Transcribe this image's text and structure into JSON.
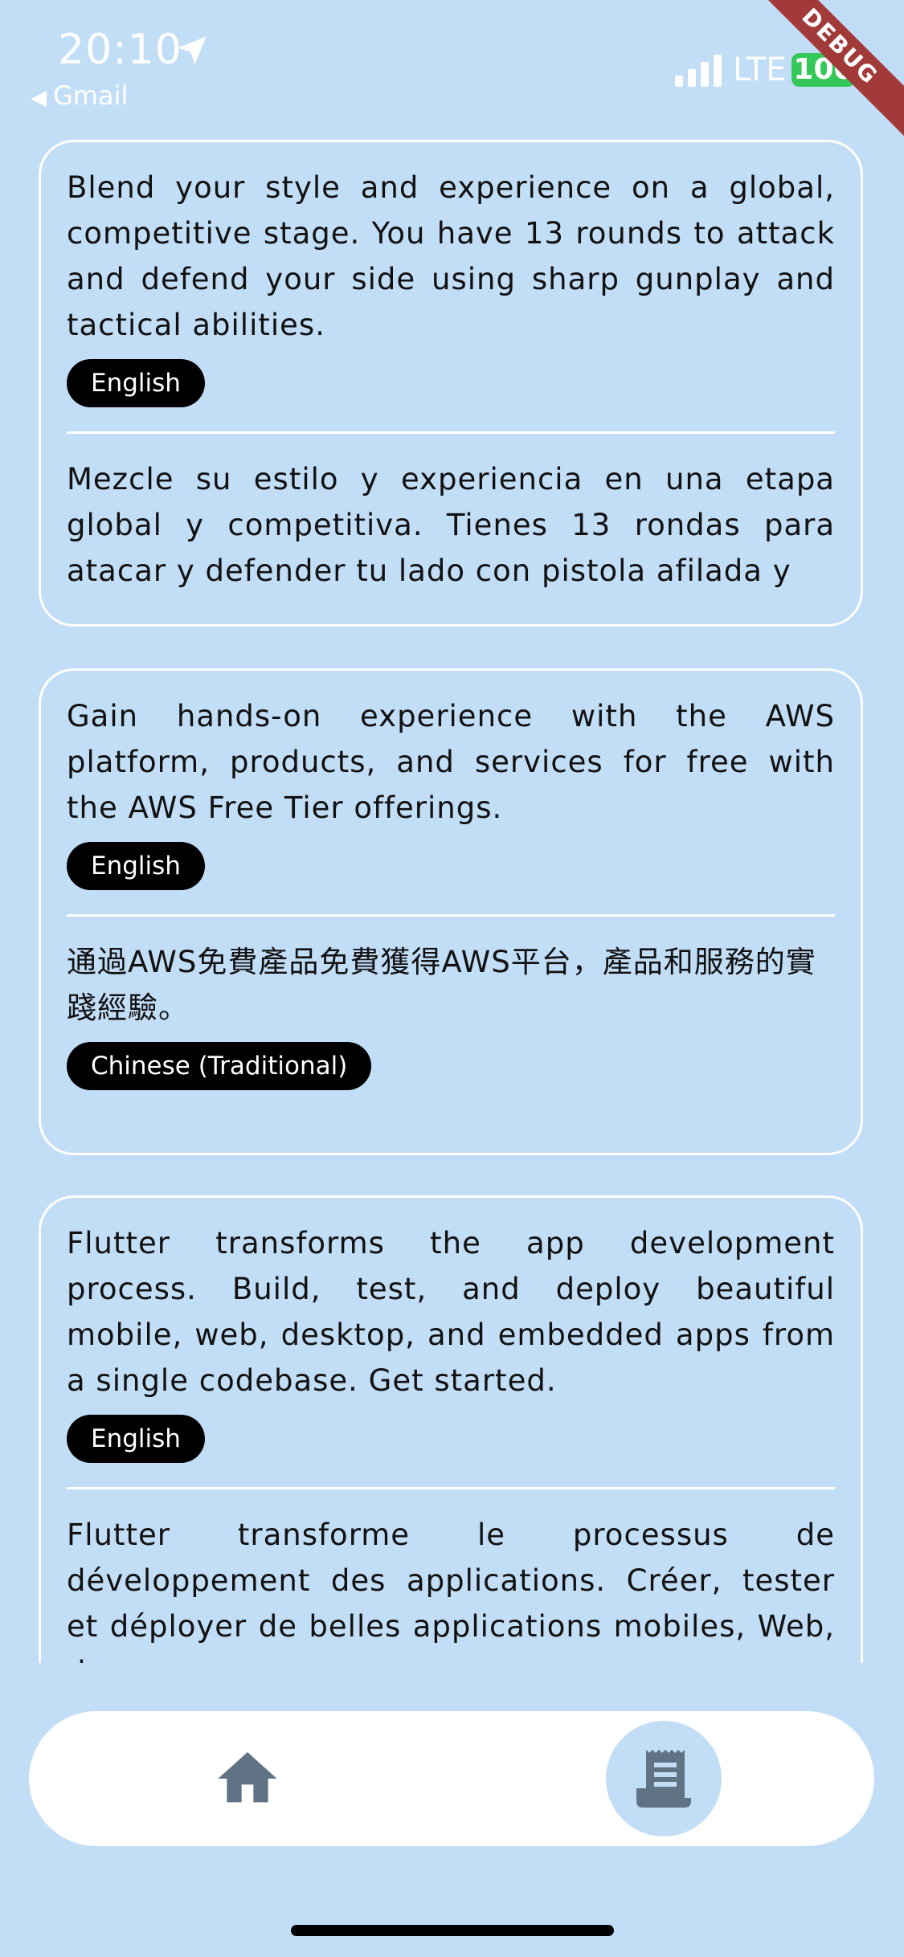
{
  "status_bar": {
    "time": "20:10",
    "back_app": "Gmail",
    "network": "LTE",
    "battery": "100",
    "debug": "DEBUG"
  },
  "cards": [
    {
      "entries": [
        {
          "text": "Blend your style and experience on a global, competitive stage. You have 13 rounds to attack and defend your side using sharp gunplay and tactical abilities.",
          "language": "English"
        },
        {
          "text": "Mezcle su estilo y experiencia en una etapa global y competitiva. Tienes 13 rondas para atacar y defender tu lado con pistola afilada y",
          "language": ""
        }
      ]
    },
    {
      "entries": [
        {
          "text": "Gain hands-on experience with the AWS platform, products, and services for free with the AWS Free Tier offerings.",
          "language": "English"
        },
        {
          "text": "通過AWS免費產品免費獲得AWS平台，產品和服務的實踐經驗。",
          "language": "Chinese (Traditional)"
        }
      ]
    },
    {
      "entries": [
        {
          "text": "Flutter transforms the app development process. Build, test, and deploy beautiful mobile, web, desktop, and embedded apps from a single codebase. Get started.",
          "language": "English"
        },
        {
          "text": "Flutter transforme le processus de développement des applications. Créer, tester et déployer de belles applications mobiles, Web, de",
          "language": ""
        }
      ]
    }
  ],
  "bottom_nav": {
    "items": [
      {
        "icon": "home-icon",
        "selected": false
      },
      {
        "icon": "receipt-icon",
        "selected": true
      }
    ]
  },
  "colors": {
    "background": "#c2ddf6",
    "nav_icon": "#5f7385",
    "tag_background": "#000000"
  }
}
